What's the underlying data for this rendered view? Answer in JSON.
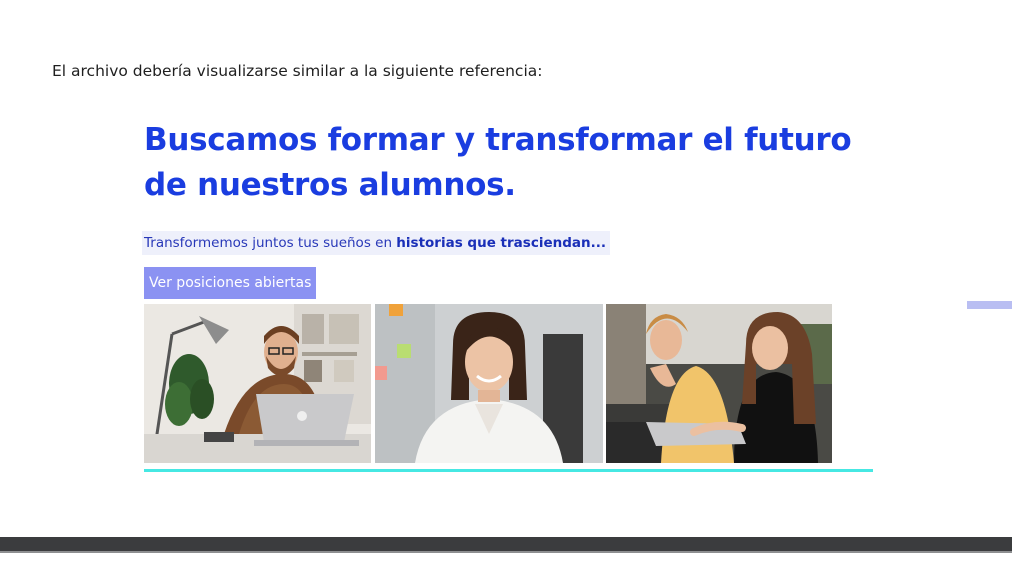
{
  "intro_text": "El archivo debería visualizarse similar a la siguiente referencia:",
  "headline": "Buscamos formar y transformar el futuro de nuestros alumnos.",
  "subtitle": {
    "prefix": "Transformemos juntos tus sueños en ",
    "bold": "historias que trasciendan..."
  },
  "cta_label": "Ver posiciones abiertas",
  "photos": [
    {
      "name": "man-with-laptop-photo"
    },
    {
      "name": "smiling-woman-photo"
    },
    {
      "name": "two-women-laptop-photo"
    }
  ],
  "colors": {
    "headline": "#1a3de0",
    "cta_background": "#8b92f2",
    "accent_line": "#46e8e3"
  }
}
